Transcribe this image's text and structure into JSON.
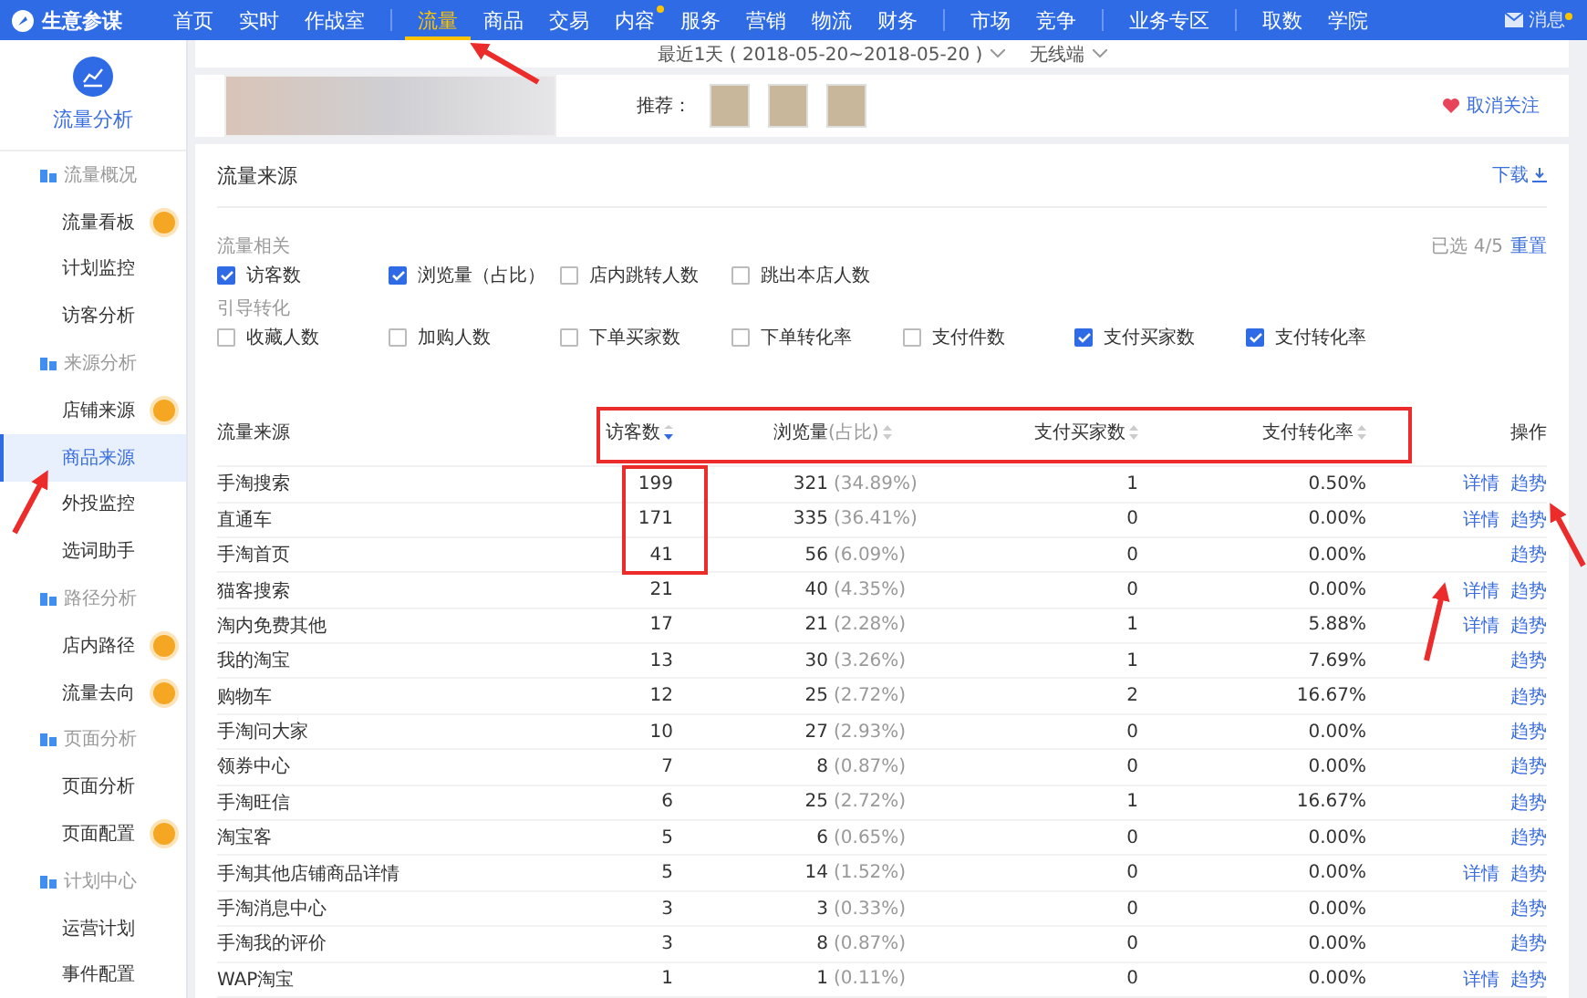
{
  "topnav": {
    "brand": "生意参谋",
    "groups": [
      [
        {
          "label": "首页",
          "selected": false,
          "dot": false
        },
        {
          "label": "实时",
          "selected": false,
          "dot": false
        },
        {
          "label": "作战室",
          "selected": false,
          "dot": false
        }
      ],
      [
        {
          "label": "流量",
          "selected": true,
          "dot": false
        },
        {
          "label": "商品",
          "selected": false,
          "dot": false
        },
        {
          "label": "交易",
          "selected": false,
          "dot": false
        },
        {
          "label": "内容",
          "selected": false,
          "dot": true
        },
        {
          "label": "服务",
          "selected": false,
          "dot": false
        },
        {
          "label": "营销",
          "selected": false,
          "dot": false
        },
        {
          "label": "物流",
          "selected": false,
          "dot": false
        },
        {
          "label": "财务",
          "selected": false,
          "dot": false
        }
      ],
      [
        {
          "label": "市场",
          "selected": false,
          "dot": false
        },
        {
          "label": "竞争",
          "selected": false,
          "dot": false
        }
      ],
      [
        {
          "label": "业务专区",
          "selected": false,
          "dot": false
        }
      ],
      [
        {
          "label": "取数",
          "selected": false,
          "dot": false
        },
        {
          "label": "学院",
          "selected": false,
          "dot": false
        }
      ]
    ],
    "message": {
      "label": "消息",
      "dot": true
    }
  },
  "sidebar": {
    "title": "流量分析",
    "groups": [
      {
        "label": "流量概况",
        "items": [
          {
            "label": "流量看板",
            "selected": false,
            "badge": true
          },
          {
            "label": "计划监控",
            "selected": false,
            "badge": false
          },
          {
            "label": "访客分析",
            "selected": false,
            "badge": false
          }
        ]
      },
      {
        "label": "来源分析",
        "items": [
          {
            "label": "店铺来源",
            "selected": false,
            "badge": true
          },
          {
            "label": "商品来源",
            "selected": true,
            "badge": false
          },
          {
            "label": "外投监控",
            "selected": false,
            "badge": false
          },
          {
            "label": "选词助手",
            "selected": false,
            "badge": false
          }
        ]
      },
      {
        "label": "路径分析",
        "items": [
          {
            "label": "店内路径",
            "selected": false,
            "badge": true
          },
          {
            "label": "流量去向",
            "selected": false,
            "badge": true
          }
        ]
      },
      {
        "label": "页面分析",
        "items": [
          {
            "label": "页面分析",
            "selected": false,
            "badge": false
          },
          {
            "label": "页面配置",
            "selected": false,
            "badge": true
          }
        ]
      },
      {
        "label": "计划中心",
        "items": [
          {
            "label": "运营计划",
            "selected": false,
            "badge": false
          },
          {
            "label": "事件配置",
            "selected": false,
            "badge": false
          }
        ]
      }
    ]
  },
  "filterbar": {
    "date_range": "最近1天 ( 2018-05-20~2018-05-20 )",
    "terminal": "无线端"
  },
  "product": {
    "recommend_label": "推荐：",
    "unfollow": "取消关注"
  },
  "section": {
    "title": "流量来源",
    "download": "下载",
    "filters": [
      {
        "label": "流量相关",
        "options": [
          {
            "label": "访客数",
            "checked": true
          },
          {
            "label": "浏览量（占比）",
            "checked": true
          },
          {
            "label": "店内跳转人数",
            "checked": false
          },
          {
            "label": "跳出本店人数",
            "checked": false
          }
        ]
      },
      {
        "label": "引导转化",
        "options": [
          {
            "label": "收藏人数",
            "checked": false
          },
          {
            "label": "加购人数",
            "checked": false
          },
          {
            "label": "下单买家数",
            "checked": false
          },
          {
            "label": "下单转化率",
            "checked": false
          },
          {
            "label": "支付件数",
            "checked": false
          },
          {
            "label": "支付买家数",
            "checked": true
          },
          {
            "label": "支付转化率",
            "checked": true
          }
        ]
      }
    ],
    "selected_count": "已选 4/5",
    "reset": "重置"
  },
  "table": {
    "columns": [
      {
        "label": "流量来源"
      },
      {
        "label": "访客数",
        "sort_active": true
      },
      {
        "label": "浏览量"
      },
      {
        "label": "(占比)",
        "sort_active": false
      },
      {
        "label": "支付买家数",
        "sort_active": false
      },
      {
        "label": "支付转化率",
        "sort_active": false
      },
      {
        "label": "操作"
      }
    ],
    "rows": [
      {
        "source": "手淘搜索",
        "visitors": "199",
        "views": "321",
        "share": "(34.89%)",
        "buyers": "1",
        "rate": "0.50%",
        "actions": [
          "详情",
          "趋势"
        ]
      },
      {
        "source": "直通车",
        "visitors": "171",
        "views": "335",
        "share": "(36.41%)",
        "buyers": "0",
        "rate": "0.00%",
        "actions": [
          "详情",
          "趋势"
        ]
      },
      {
        "source": "手淘首页",
        "visitors": "41",
        "views": "56",
        "share": "(6.09%)",
        "buyers": "0",
        "rate": "0.00%",
        "actions": [
          "趋势"
        ]
      },
      {
        "source": "猫客搜索",
        "visitors": "21",
        "views": "40",
        "share": "(4.35%)",
        "buyers": "0",
        "rate": "0.00%",
        "actions": [
          "详情",
          "趋势"
        ]
      },
      {
        "source": "淘内免费其他",
        "visitors": "17",
        "views": "21",
        "share": "(2.28%)",
        "buyers": "1",
        "rate": "5.88%",
        "actions": [
          "详情",
          "趋势"
        ]
      },
      {
        "source": "我的淘宝",
        "visitors": "13",
        "views": "30",
        "share": "(3.26%)",
        "buyers": "1",
        "rate": "7.69%",
        "actions": [
          "趋势"
        ]
      },
      {
        "source": "购物车",
        "visitors": "12",
        "views": "25",
        "share": "(2.72%)",
        "buyers": "2",
        "rate": "16.67%",
        "actions": [
          "趋势"
        ]
      },
      {
        "source": "手淘问大家",
        "visitors": "10",
        "views": "27",
        "share": "(2.93%)",
        "buyers": "0",
        "rate": "0.00%",
        "actions": [
          "趋势"
        ]
      },
      {
        "source": "领券中心",
        "visitors": "7",
        "views": "8",
        "share": "(0.87%)",
        "buyers": "0",
        "rate": "0.00%",
        "actions": [
          "趋势"
        ]
      },
      {
        "source": "手淘旺信",
        "visitors": "6",
        "views": "25",
        "share": "(2.72%)",
        "buyers": "1",
        "rate": "16.67%",
        "actions": [
          "趋势"
        ]
      },
      {
        "source": "淘宝客",
        "visitors": "5",
        "views": "6",
        "share": "(0.65%)",
        "buyers": "0",
        "rate": "0.00%",
        "actions": [
          "趋势"
        ]
      },
      {
        "source": "手淘其他店铺商品详情",
        "visitors": "5",
        "views": "14",
        "share": "(1.52%)",
        "buyers": "0",
        "rate": "0.00%",
        "actions": [
          "详情",
          "趋势"
        ]
      },
      {
        "source": "手淘消息中心",
        "visitors": "3",
        "views": "3",
        "share": "(0.33%)",
        "buyers": "0",
        "rate": "0.00%",
        "actions": [
          "趋势"
        ]
      },
      {
        "source": "手淘我的评价",
        "visitors": "3",
        "views": "8",
        "share": "(0.87%)",
        "buyers": "0",
        "rate": "0.00%",
        "actions": [
          "趋势"
        ]
      },
      {
        "source": "WAP淘宝",
        "visitors": "1",
        "views": "1",
        "share": "(0.11%)",
        "buyers": "0",
        "rate": "0.00%",
        "actions": [
          "详情",
          "趋势"
        ]
      }
    ]
  }
}
